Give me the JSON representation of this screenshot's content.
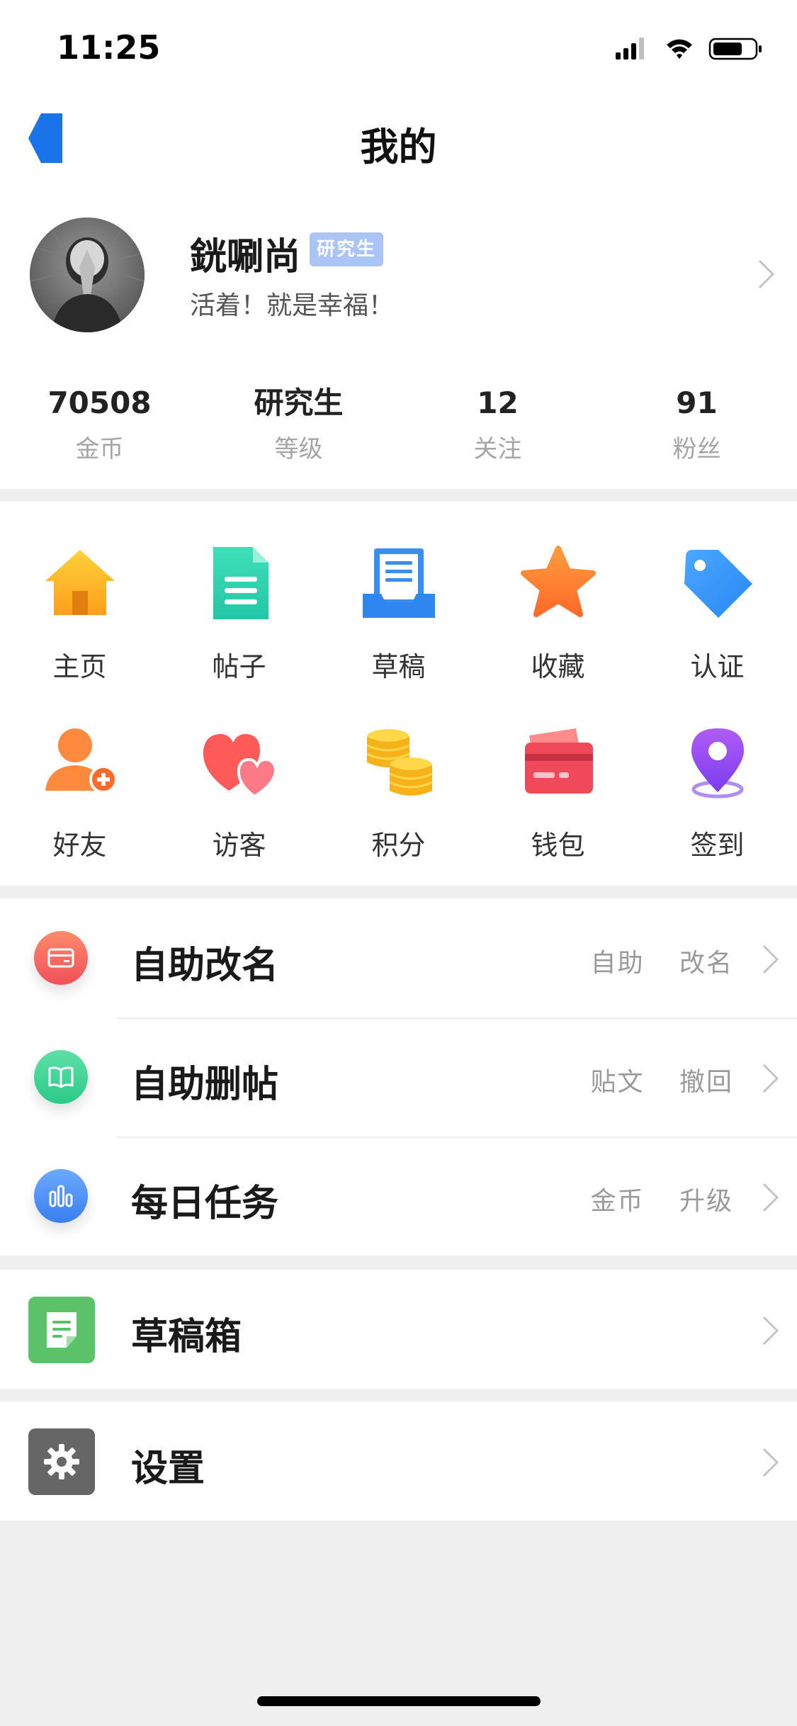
{
  "status_bar": {
    "time": "11:25"
  },
  "nav": {
    "title": "我的"
  },
  "profile": {
    "username": "銧唰尚",
    "badge": "研究生",
    "signature": "活着！就是幸福！"
  },
  "stats": [
    {
      "value": "70508",
      "label": "金币"
    },
    {
      "value": "研究生",
      "label": "等级"
    },
    {
      "value": "12",
      "label": "关注"
    },
    {
      "value": "91",
      "label": "粉丝"
    }
  ],
  "grid": [
    {
      "label": "主页",
      "icon": "home-icon"
    },
    {
      "label": "帖子",
      "icon": "document-icon"
    },
    {
      "label": "草稿",
      "icon": "draft-tray-icon"
    },
    {
      "label": "收藏",
      "icon": "star-icon"
    },
    {
      "label": "认证",
      "icon": "tag-icon"
    },
    {
      "label": "好友",
      "icon": "add-friend-icon"
    },
    {
      "label": "访客",
      "icon": "hearts-icon"
    },
    {
      "label": "积分",
      "icon": "coins-icon"
    },
    {
      "label": "钱包",
      "icon": "wallet-card-icon"
    },
    {
      "label": "签到",
      "icon": "location-pin-icon"
    }
  ],
  "menu": [
    {
      "title": "自助改名",
      "tags": [
        "自助",
        "改名"
      ],
      "icon": "card-icon",
      "color": "#f26b5b"
    },
    {
      "title": "自助删帖",
      "tags": [
        "贴文",
        "撤回"
      ],
      "icon": "book-icon",
      "color": "#3fd49a"
    },
    {
      "title": "每日任务",
      "tags": [
        "金币",
        "升级"
      ],
      "icon": "bar-chart-icon",
      "color": "#4a8ff7"
    }
  ],
  "drafts": {
    "title": "草稿箱",
    "icon": "draft-note-icon",
    "color": "#5cc26a"
  },
  "settings": {
    "title": "设置",
    "icon": "gear-icon",
    "color": "#666666"
  }
}
